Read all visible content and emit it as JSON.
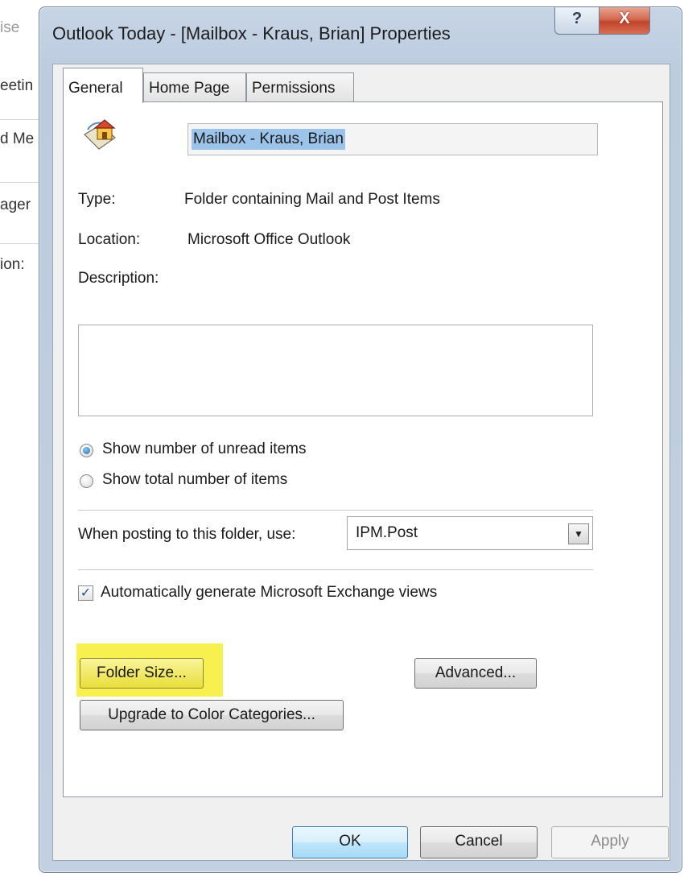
{
  "background": {
    "fragments": [
      "ise",
      "eetin",
      "d Me",
      "ager",
      "ion:"
    ]
  },
  "dialog": {
    "title": "Outlook Today - [Mailbox - Kraus, Brian] Properties",
    "help_glyph": "?",
    "close_glyph": "X"
  },
  "tabs": [
    {
      "label": "General",
      "active": true
    },
    {
      "label": "Home Page",
      "active": false
    },
    {
      "label": "Permissions",
      "active": false
    }
  ],
  "general": {
    "folder_icon": "home-folder-icon",
    "folder_name": "Mailbox - Kraus, Brian",
    "type_label": "Type:",
    "type_value": "Folder containing Mail and Post Items",
    "location_label": "Location:",
    "location_value": "Microsoft Office Outlook",
    "description_label": "Description:",
    "description_value": "",
    "radio_unread": "Show number of unread items",
    "radio_total": "Show total number of items",
    "radio_selected": "unread",
    "posting_label": "When posting to this folder, use:",
    "posting_value": "IPM.Post",
    "auto_views_label": "Automatically generate Microsoft Exchange views",
    "auto_views_checked": true,
    "folder_size_button": "Folder Size...",
    "advanced_button": "Advanced...",
    "upgrade_button": "Upgrade to Color Categories..."
  },
  "footer": {
    "ok": "OK",
    "cancel": "Cancel",
    "apply": "Apply"
  },
  "colors": {
    "highlight": "#f7f04e",
    "selection": "#9cc3ea",
    "close_button": "#c0442a"
  }
}
